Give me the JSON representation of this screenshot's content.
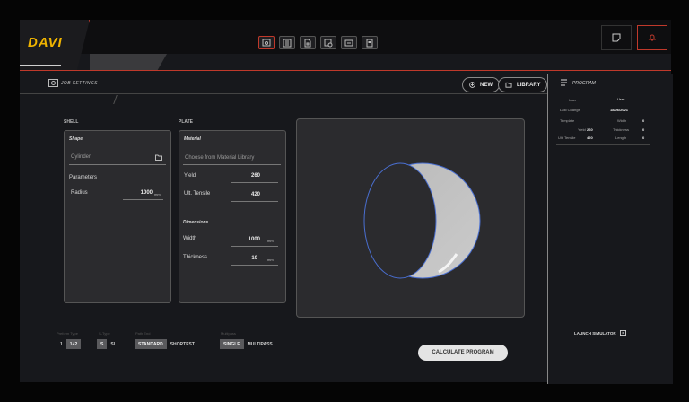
{
  "app": {
    "logo": "DAVI"
  },
  "toolbar": {
    "icons": [
      "job-settings-icon",
      "list-icon",
      "document-icon",
      "settings-doc-icon",
      "monitor-icon",
      "report-icon"
    ]
  },
  "header": {
    "title": "JOB SETTINGS",
    "new_label": "NEW",
    "library_label": "LIBRARY"
  },
  "shell": {
    "section": "SHELL",
    "card_title": "Shape",
    "shape_value": "Cylinder",
    "parameters_label": "Parameters",
    "radius_label": "Radius",
    "radius_value": "1000",
    "radius_unit": "mm"
  },
  "plate": {
    "section": "PLATE",
    "material_title": "Material",
    "material_placeholder": "Choose from Material Library",
    "yield_label": "Yield",
    "yield_value": "260",
    "tensile_label": "Ult. Tensile",
    "tensile_value": "420",
    "dimensions_title": "Dimensions",
    "width_label": "Width",
    "width_value": "1000",
    "width_unit": "mm",
    "thickness_label": "Thickness",
    "thickness_value": "10",
    "thickness_unit": "mm"
  },
  "program": {
    "title": "PROGRAM",
    "user_label": "User",
    "user_value": "User",
    "last_change_label": "Last Change",
    "last_change_value": "18/06/2021",
    "template_label": "Template",
    "yield_label": "Yield",
    "yield_value": "260",
    "tensile_label": "Ult. Tensile",
    "tensile_value": "420",
    "width_label": "Width",
    "width_value": "0",
    "thickness_label": "Thickness",
    "thickness_value": "0",
    "length_label": "Length",
    "length_value": "0",
    "launch_label": "LAUNCH SIMULATOR"
  },
  "options": {
    "preform_label": "Preform Type",
    "preform": [
      "1",
      "1+2"
    ],
    "type_label": "S-Type",
    "type": [
      "S",
      "SI"
    ],
    "path_label": "Path End",
    "path": [
      "STANDARD",
      "SHORTEST"
    ],
    "pass_label": "Multipass",
    "pass": [
      "SINGLE",
      "MULTIPASS"
    ]
  },
  "actions": {
    "calculate_label": "CALCULATE PROGRAM"
  },
  "colors": {
    "accent": "#c0392b",
    "logo": "#f0b400",
    "ring_edge": "#4a6fd1"
  }
}
